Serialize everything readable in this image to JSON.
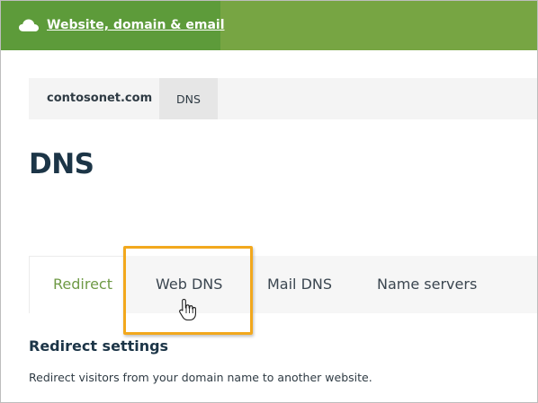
{
  "header": {
    "link_label": "Website, domain & email",
    "icon": "cloud-icon",
    "colors": {
      "bar": "#77a543",
      "tab": "#5d9b3a"
    }
  },
  "breadcrumb": {
    "domain": "contosonet.com",
    "current": "DNS"
  },
  "page": {
    "title": "DNS"
  },
  "tabs": [
    {
      "label": "Redirect",
      "active": true
    },
    {
      "label": "Web DNS",
      "active": false,
      "highlighted": true
    },
    {
      "label": "Mail DNS",
      "active": false
    },
    {
      "label": "Name servers",
      "active": false
    }
  ],
  "section": {
    "title": "Redirect settings",
    "description": "Redirect visitors from your domain name to another website."
  },
  "colors": {
    "active_tab": "#6f9a46",
    "highlight": "#f2a81d"
  }
}
